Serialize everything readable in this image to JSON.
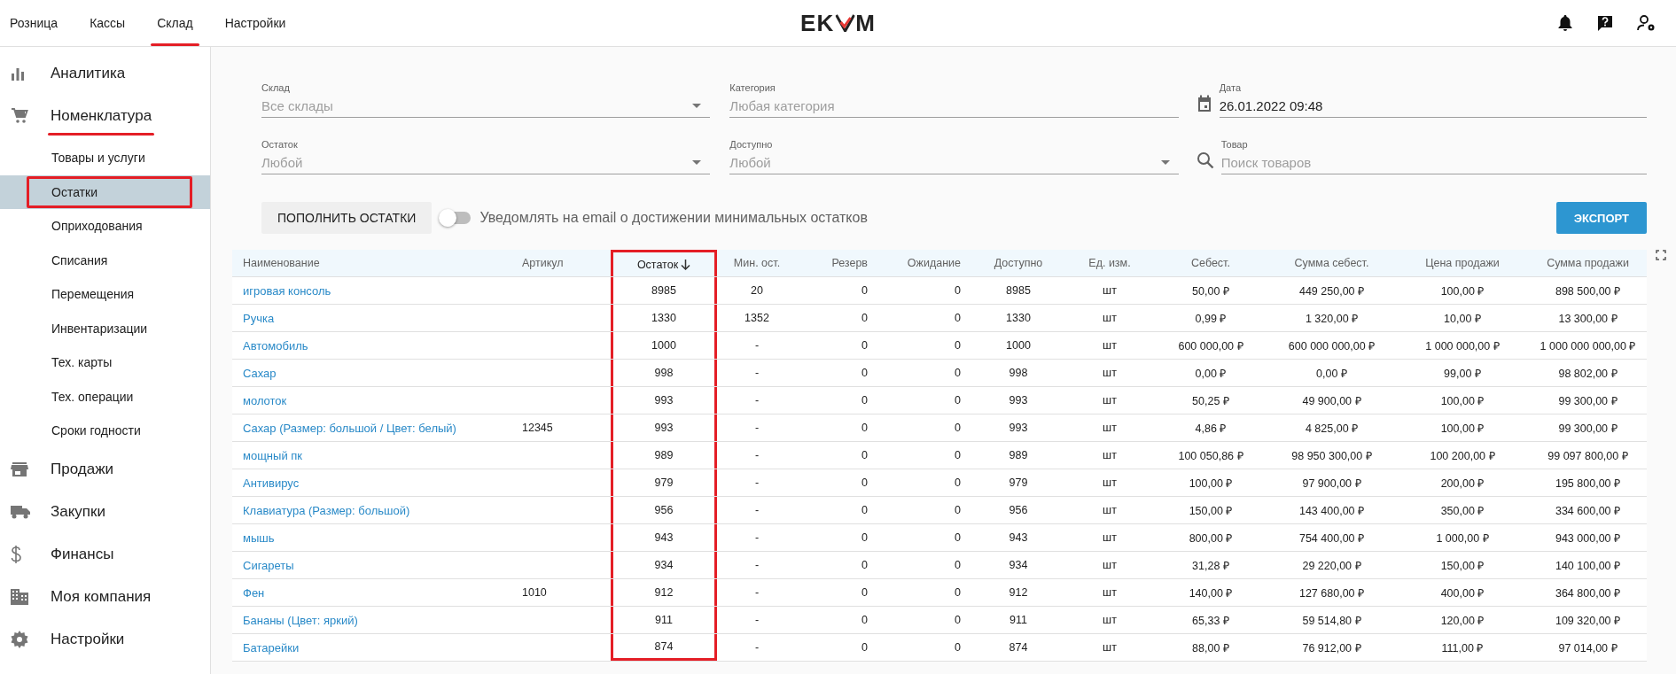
{
  "top_nav": {
    "tabs": [
      {
        "label": "Розница",
        "selected": false
      },
      {
        "label": "Кассы",
        "selected": false
      },
      {
        "label": "Склад",
        "selected": true
      },
      {
        "label": "Настройки",
        "selected": false
      }
    ],
    "logo": {
      "left": "EK",
      "right": "M"
    }
  },
  "sidebar": {
    "items": [
      {
        "label": "Аналитика",
        "selected": false
      },
      {
        "label": "Номенклатура",
        "selected": true,
        "children": [
          {
            "label": "Товары и услуги",
            "selected": false,
            "highlighted": false
          },
          {
            "label": "Остатки",
            "selected": true,
            "highlighted": true
          },
          {
            "label": "Оприходования",
            "selected": false,
            "highlighted": false
          },
          {
            "label": "Списания",
            "selected": false,
            "highlighted": false
          },
          {
            "label": "Перемещения",
            "selected": false,
            "highlighted": false
          },
          {
            "label": "Инвентаризации",
            "selected": false,
            "highlighted": false
          },
          {
            "label": "Тех. карты",
            "selected": false,
            "highlighted": false
          },
          {
            "label": "Тех. операции",
            "selected": false,
            "highlighted": false
          },
          {
            "label": "Сроки годности",
            "selected": false,
            "highlighted": false
          }
        ]
      },
      {
        "label": "Продажи",
        "selected": false
      },
      {
        "label": "Закупки",
        "selected": false
      },
      {
        "label": "Финансы",
        "selected": false
      },
      {
        "label": "Моя компания",
        "selected": false
      },
      {
        "label": "Настройки",
        "selected": false
      }
    ]
  },
  "filters": [
    {
      "kind": "select",
      "label": "Склад",
      "placeholder": "Все склады"
    },
    {
      "kind": "text",
      "label": "Категория",
      "placeholder": "Любая категория"
    },
    {
      "kind": "date",
      "label": "Дата",
      "value": "26.01.2022 09:48"
    },
    {
      "kind": "select",
      "label": "Остаток",
      "placeholder": "Любой"
    },
    {
      "kind": "select",
      "label": "Доступно",
      "placeholder": "Любой"
    },
    {
      "kind": "search",
      "label": "Товар",
      "placeholder": "Поиск товаров"
    }
  ],
  "toolbar": {
    "replenish_button": "ПОПОЛНИТЬ ОСТАТКИ",
    "notify_toggle": {
      "label": "Уведомлять на email о достижении минимальных остатков",
      "on": false
    },
    "export_button": "ЭКСПОРТ"
  },
  "table": {
    "columns": [
      {
        "label": "Наименование",
        "sorted": false,
        "highlighted": false
      },
      {
        "label": "Артикул",
        "sorted": false,
        "highlighted": false
      },
      {
        "label": "Остаток",
        "sorted": true,
        "highlighted": true
      },
      {
        "label": "Мин. ост.",
        "sorted": false,
        "highlighted": false
      },
      {
        "label": "Резерв",
        "sorted": false,
        "highlighted": false
      },
      {
        "label": "Ожидание",
        "sorted": false,
        "highlighted": false
      },
      {
        "label": "Доступно",
        "sorted": false,
        "highlighted": false
      },
      {
        "label": "Ед. изм.",
        "sorted": false,
        "highlighted": false
      },
      {
        "label": "Себест.",
        "sorted": false,
        "highlighted": false
      },
      {
        "label": "Сумма себест.",
        "sorted": false,
        "highlighted": false
      },
      {
        "label": "Цена продажи",
        "sorted": false,
        "highlighted": false
      },
      {
        "label": "Сумма продажи",
        "sorted": false,
        "highlighted": false
      }
    ],
    "rows": [
      [
        "игровая консоль",
        "",
        "8985",
        "20",
        "0",
        "0",
        "8985",
        "шт",
        "50,00 ₽",
        "449 250,00 ₽",
        "100,00 ₽",
        "898 500,00 ₽"
      ],
      [
        "Ручка",
        "",
        "1330",
        "1352",
        "0",
        "0",
        "1330",
        "шт",
        "0,99 ₽",
        "1 320,00 ₽",
        "10,00 ₽",
        "13 300,00 ₽"
      ],
      [
        "Автомобиль",
        "",
        "1000",
        "-",
        "0",
        "0",
        "1000",
        "шт",
        "600 000,00 ₽",
        "600 000 000,00 ₽",
        "1 000 000,00 ₽",
        "1 000 000 000,00 ₽"
      ],
      [
        "Сахар",
        "",
        "998",
        "-",
        "0",
        "0",
        "998",
        "шт",
        "0,00 ₽",
        "0,00 ₽",
        "99,00 ₽",
        "98 802,00 ₽"
      ],
      [
        "молоток",
        "",
        "993",
        "-",
        "0",
        "0",
        "993",
        "шт",
        "50,25 ₽",
        "49 900,00 ₽",
        "100,00 ₽",
        "99 300,00 ₽"
      ],
      [
        "Сахар (Размер: большой / Цвет: белый)",
        "12345",
        "993",
        "-",
        "0",
        "0",
        "993",
        "шт",
        "4,86 ₽",
        "4 825,00 ₽",
        "100,00 ₽",
        "99 300,00 ₽"
      ],
      [
        "мощный пк",
        "",
        "989",
        "-",
        "0",
        "0",
        "989",
        "шт",
        "100 050,86 ₽",
        "98 950 300,00 ₽",
        "100 200,00 ₽",
        "99 097 800,00 ₽"
      ],
      [
        "Антивирус",
        "",
        "979",
        "-",
        "0",
        "0",
        "979",
        "шт",
        "100,00 ₽",
        "97 900,00 ₽",
        "200,00 ₽",
        "195 800,00 ₽"
      ],
      [
        "Клавиатура (Размер: большой)",
        "",
        "956",
        "-",
        "0",
        "0",
        "956",
        "шт",
        "150,00 ₽",
        "143 400,00 ₽",
        "350,00 ₽",
        "334 600,00 ₽"
      ],
      [
        "мышь",
        "",
        "943",
        "-",
        "0",
        "0",
        "943",
        "шт",
        "800,00 ₽",
        "754 400,00 ₽",
        "1 000,00 ₽",
        "943 000,00 ₽"
      ],
      [
        "Сигареты",
        "",
        "934",
        "-",
        "0",
        "0",
        "934",
        "шт",
        "31,28 ₽",
        "29 220,00 ₽",
        "150,00 ₽",
        "140 100,00 ₽"
      ],
      [
        "Фен",
        "1010",
        "912",
        "-",
        "0",
        "0",
        "912",
        "шт",
        "140,00 ₽",
        "127 680,00 ₽",
        "400,00 ₽",
        "364 800,00 ₽"
      ],
      [
        "Бананы (Цвет: яркий)",
        "",
        "911",
        "-",
        "0",
        "0",
        "911",
        "шт",
        "65,33 ₽",
        "59 514,80 ₽",
        "120,00 ₽",
        "109 320,00 ₽"
      ],
      [
        "Батарейки",
        "",
        "874",
        "-",
        "0",
        "0",
        "874",
        "шт",
        "88,00 ₽",
        "76 912,00 ₽",
        "111,00 ₽",
        "97 014,00 ₽"
      ]
    ]
  }
}
